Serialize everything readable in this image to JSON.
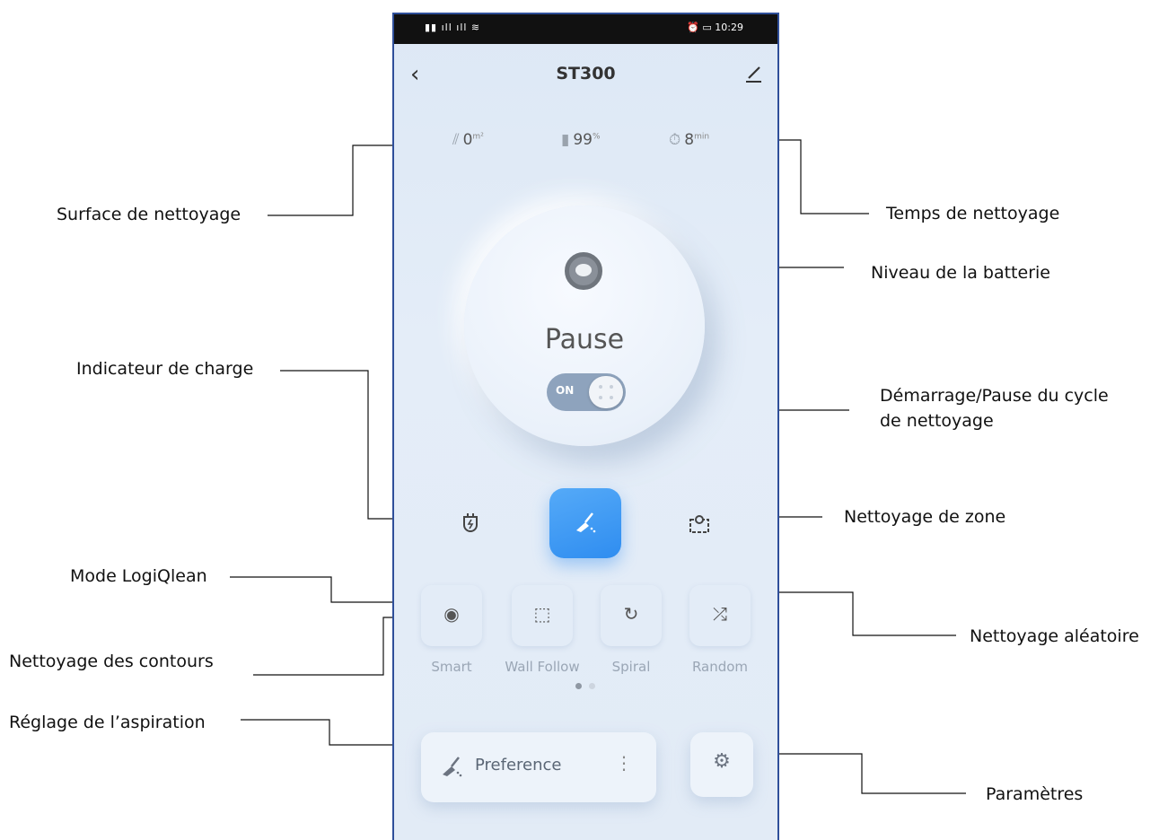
{
  "annotations": {
    "surface": "Surface de nettoyage",
    "temps": "Temps de nettoyage",
    "batterie": "Niveau de la batterie",
    "charge": "Indicateur de charge",
    "demarrage_l1": "Démarrage/Pause du cycle",
    "demarrage_l2": "de nettoyage",
    "zone": "Nettoyage de zone",
    "logiqlean": "Mode LogiQlean",
    "contours": "Nettoyage des contours",
    "aleatoire": "Nettoyage aléatoire",
    "aspiration": "Réglage de l’aspiration",
    "parametres": "Paramètres"
  },
  "status_bar": {
    "time": "10:29"
  },
  "header": {
    "title": "ST300",
    "back_icon": "chevron-left-icon",
    "edit_icon": "pencil-icon"
  },
  "stats": {
    "area_value": "0",
    "area_unit": "m²",
    "battery_value": "99",
    "battery_unit": "%",
    "time_value": "8",
    "time_unit": "min"
  },
  "main": {
    "status_label": "Pause",
    "toggle_label": "ON",
    "toggle_on": true
  },
  "modes": [
    {
      "label": "Smart",
      "icon": "robot-icon"
    },
    {
      "label": "Wall Follow",
      "icon": "wall-icon"
    },
    {
      "label": "Spiral",
      "icon": "spiral-icon"
    },
    {
      "label": "Random",
      "icon": "shuffle-icon"
    }
  ],
  "bottom": {
    "preference_label": "Preference"
  },
  "colors": {
    "accent": "#3a93f3",
    "frame": "#2f4f9a"
  }
}
